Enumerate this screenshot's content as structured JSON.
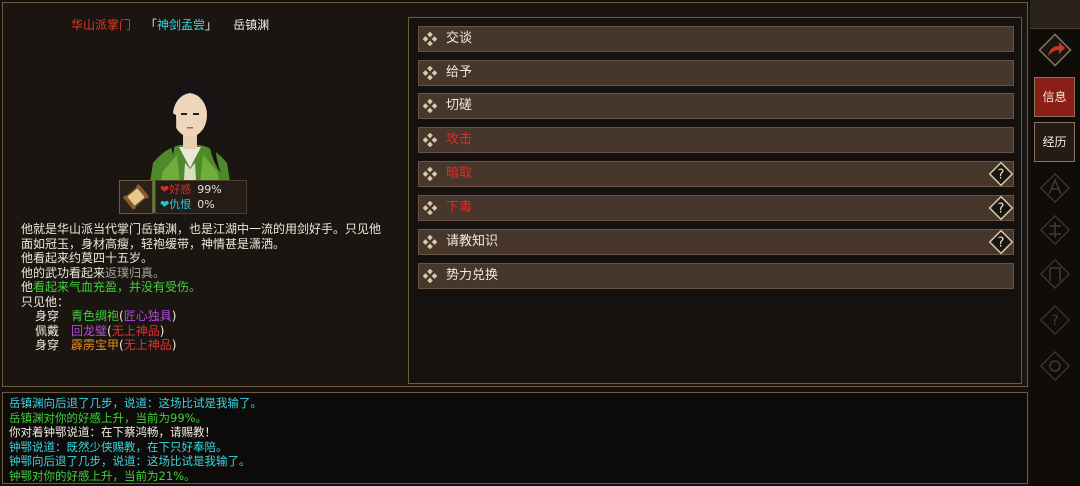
{
  "header": {
    "sect": "华山派掌门",
    "nickname_open": "「",
    "nickname": "神剑孟尝",
    "nickname_close": "」",
    "name": "岳镇渊"
  },
  "stats": [
    {
      "label": "好感",
      "value": "99%",
      "color": "#e02a2a"
    },
    {
      "label": "仇恨",
      "value": "0%",
      "color": "#22c8d4"
    }
  ],
  "description": {
    "intro": "他就是华山派当代掌门岳镇渊，也是江湖中一流的用剑好手。只见他面如冠玉，身材高瘦，轻袍缓带，神情甚是潇洒。",
    "age": "他看起来约莫四十五岁。",
    "martial_prefix": "他的武功看起来",
    "martial_value": "返璞归真。",
    "health_prefix": "他",
    "health_value": "看起来气血充盈，并没有受伤。",
    "see_label": "只见他：",
    "equipment": [
      {
        "kind": "身穿",
        "item": "青色绸袍",
        "q_open": "(",
        "quality": "匠心独具",
        "q_close": ")",
        "item_color": "#3fd23a",
        "quality_color": "#b24ae0"
      },
      {
        "kind": "佩戴",
        "item": "回龙璧",
        "q_open": "(",
        "quality": "无上神品",
        "q_close": ")",
        "item_color": "#b24ae0",
        "quality_color": "#e03030"
      },
      {
        "kind": "身穿",
        "item": "霹雳宝甲",
        "q_open": "(",
        "quality": "无上神品",
        "q_close": ")",
        "item_color": "#e88a1a",
        "quality_color": "#e03030"
      }
    ]
  },
  "actions": [
    {
      "label": "交谈",
      "danger": false,
      "help": false
    },
    {
      "label": "给予",
      "danger": false,
      "help": false
    },
    {
      "label": "切磋",
      "danger": false,
      "help": false
    },
    {
      "label": "攻击",
      "danger": true,
      "help": false
    },
    {
      "label": "暗取",
      "danger": true,
      "help": true
    },
    {
      "label": "下毒",
      "danger": true,
      "help": true
    },
    {
      "label": "请教知识",
      "danger": false,
      "help": true
    },
    {
      "label": "势力兑换",
      "danger": false,
      "help": false
    }
  ],
  "side": {
    "tab_info": "信息",
    "tab_history": "经历"
  },
  "log": [
    {
      "text": "岳镇渊向后退了几步，说道：这场比试是我输了。",
      "color": "#3ad6e0"
    },
    {
      "text": "岳镇渊对你的好感上升，当前为99%。",
      "color": "#3fd23a"
    },
    {
      "text": "你对着钟鄂说道：在下蔡鸿畅，请赐教！",
      "color": "#f2ede2"
    },
    {
      "text": "钟鄂说道：既然少侠赐教，在下只好奉陪。",
      "color": "#3ad6e0"
    },
    {
      "text": "钟鄂向后退了几步，说道：这场比试是我输了。",
      "color": "#3ad6e0"
    },
    {
      "text": "钟鄂对你的好感上升，当前为21%。",
      "color": "#3fd23a"
    }
  ],
  "icons": {
    "action_bullet": "diamond-cluster-icon",
    "help": "question-diamond-icon",
    "share": "share-arrow-icon",
    "stats": "scroll-icon"
  }
}
